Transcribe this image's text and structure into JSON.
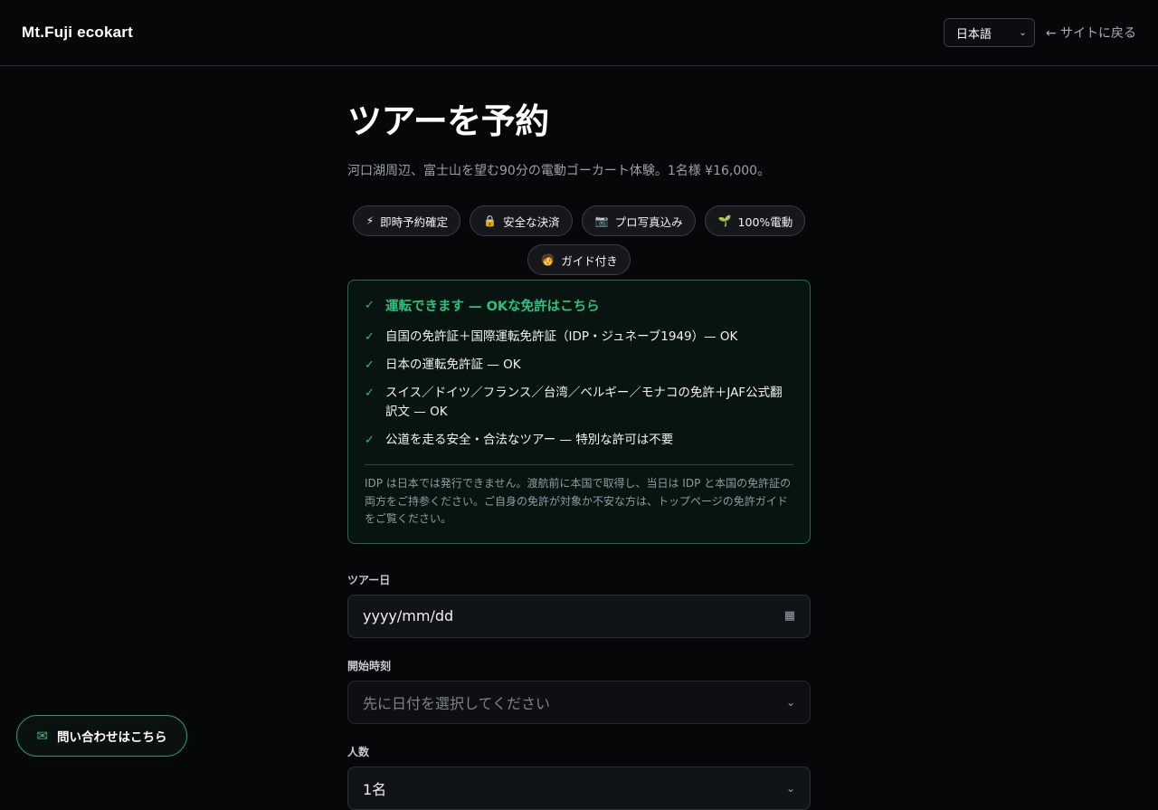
{
  "header": {
    "brand": "Mt.Fuji ecokart",
    "language_selected": "日本語",
    "back_link": "← サイトに戻る"
  },
  "page": {
    "title": "ツアーを予約",
    "subtitle": "河口湖周辺、富士山を望む90分の電動ゴーカート体験。1名様 ¥16,000。"
  },
  "chips": [
    {
      "icon": "lightning-icon",
      "glyph": "⚡",
      "label": "即時予約確定"
    },
    {
      "icon": "lock-icon",
      "glyph": "🔒",
      "label": "安全な決済"
    },
    {
      "icon": "camera-icon",
      "glyph": "📷",
      "label": "プロ写真込み"
    },
    {
      "icon": "sprout-icon",
      "glyph": "🌱",
      "label": "100%電動"
    },
    {
      "icon": "guide-icon",
      "glyph": "🧑",
      "label": "ガイド付き"
    }
  ],
  "license": {
    "title": "運転できます — OKな免許はこちら",
    "items": [
      "自国の免許証＋国際運転免許証（IDP・ジュネーブ1949）— OK",
      "日本の運転免許証 — OK",
      "スイス／ドイツ／フランス／台湾／ベルギー／モナコの免許＋JAF公式翻訳文 — OK",
      "公道を走る安全・合法なツアー — 特別な許可は不要"
    ],
    "note": "IDP は日本では発行できません。渡航前に本国で取得し、当日は IDP と本国の免許証の両方をご持参ください。ご自身の免許が対象か不安な方は、トップページの免許ガイドをご覧ください。"
  },
  "form": {
    "date_label": "ツアー日",
    "date_placeholder": "yyyy/mm/dd",
    "time_label": "開始時刻",
    "time_placeholder": "先に日付を選択してください",
    "people_label": "人数",
    "people_value": "1名"
  },
  "contact_button": "問い合わせはこちら",
  "colors": {
    "accent": "#27c283",
    "background": "#060709"
  }
}
